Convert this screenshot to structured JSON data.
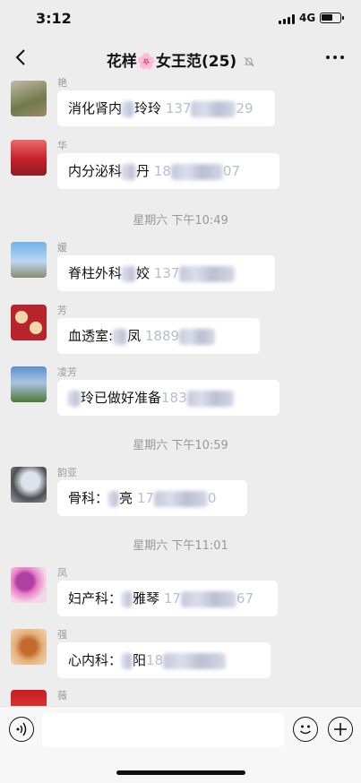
{
  "status_bar": {
    "time": "3:12",
    "network": "4G"
  },
  "nav": {
    "title": "花样🌸女王范(25)"
  },
  "icons": {
    "back": "chevron-left-icon",
    "mute": "bell-muted-icon",
    "more": "more-dots-icon",
    "voice": "voice-icon",
    "emoji": "emoji-icon",
    "plus": "plus-icon"
  },
  "messages": [
    {
      "sender": "艳",
      "text_before": "消化肾内",
      "text_after": "玲玲",
      "number_visible": "137",
      "number_tail": "29"
    },
    {
      "sender": "华",
      "text_before": "内分泌科",
      "text_after": "丹",
      "number_visible": "18",
      "number_tail": "07"
    },
    {
      "sender": "媛",
      "text_before": "脊柱外科",
      "text_after": "姣",
      "number_visible": "137",
      "number_tail": ""
    },
    {
      "sender": "芳",
      "text_before": "血透室:",
      "text_after": "凤",
      "number_visible": "1889",
      "number_tail": ""
    },
    {
      "sender": "凌芳",
      "text_before": "",
      "text_after": "玲已做好准备",
      "number_visible": "183",
      "number_tail": ""
    },
    {
      "sender": "韵亚",
      "text_before": "骨科：",
      "text_after": "亮",
      "number_visible": "17",
      "number_tail": "0"
    },
    {
      "sender": "凤",
      "text_before": "妇产科：",
      "text_after": "雅琴",
      "number_visible": "17",
      "number_tail": "67"
    },
    {
      "sender": "强",
      "text_before": "心内科：",
      "text_after": "阳",
      "number_visible": "18",
      "number_tail": ""
    },
    {
      "sender": "薇"
    }
  ],
  "timestamps": [
    "星期六 下午10:49",
    "星期六 下午10:59",
    "星期六 下午11:01"
  ]
}
